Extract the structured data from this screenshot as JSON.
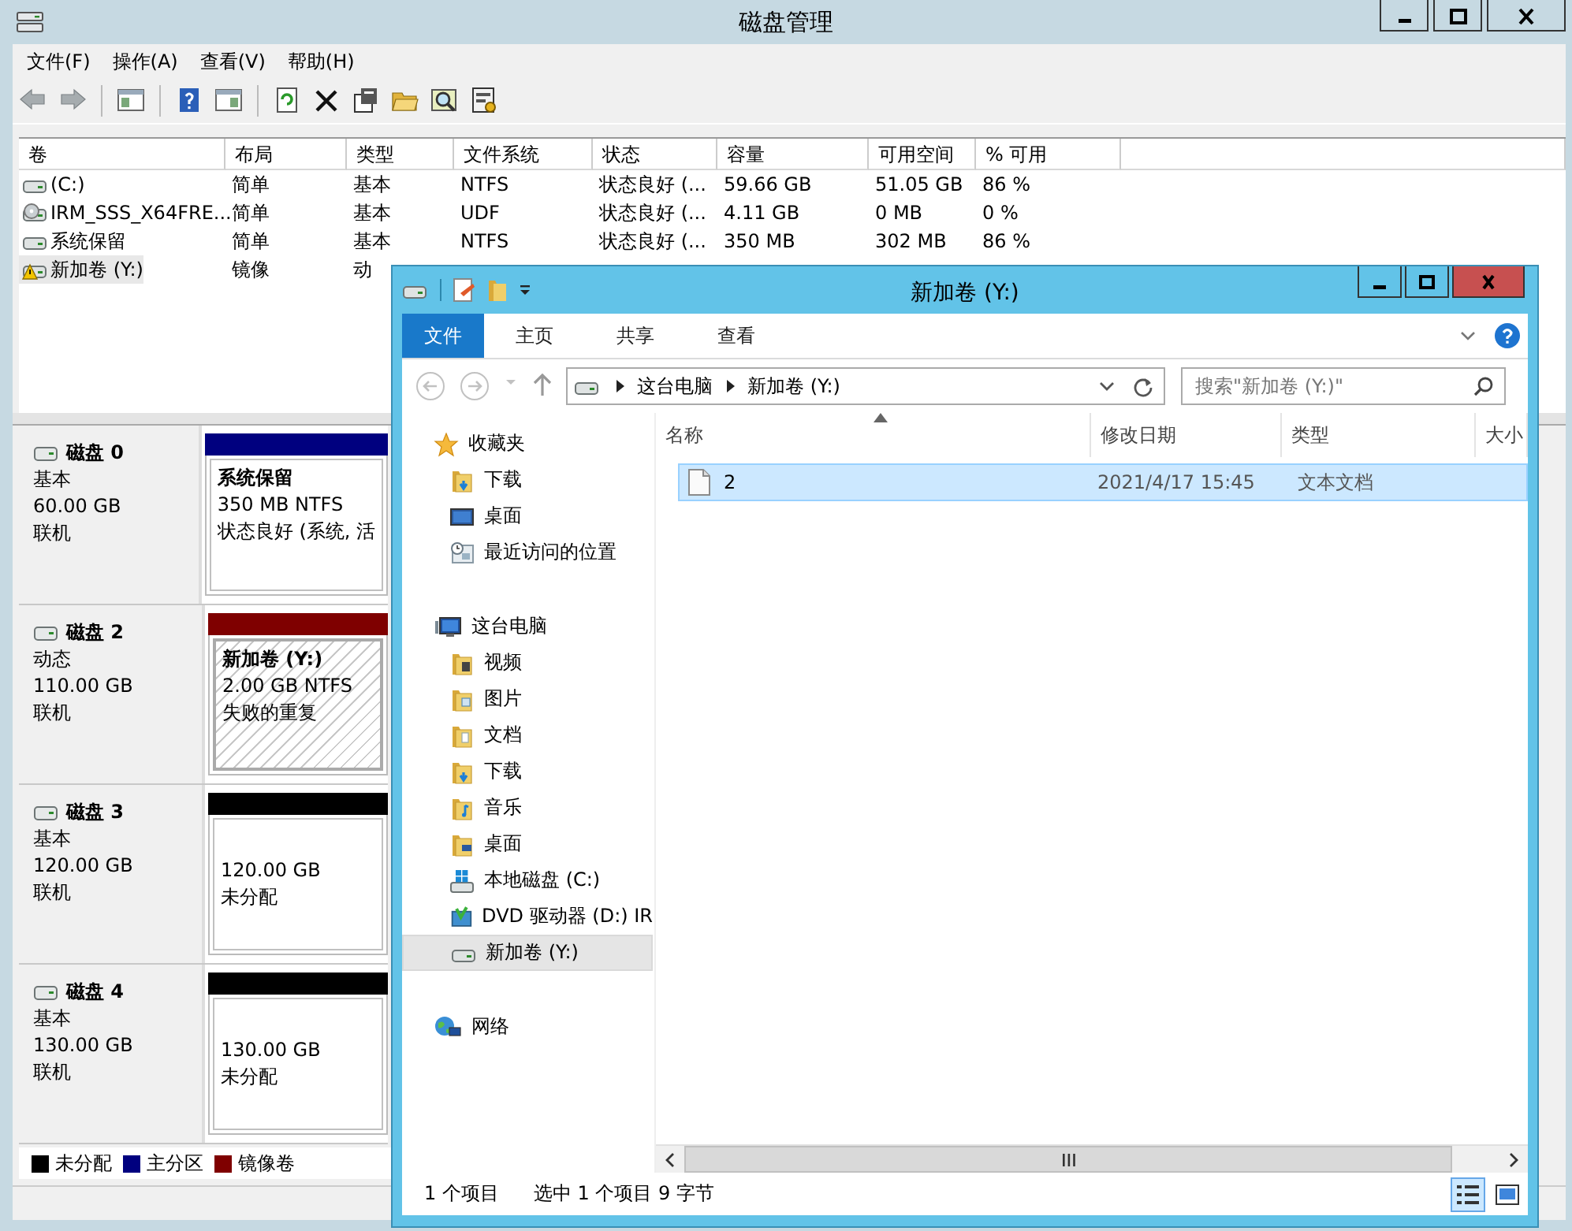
{
  "window": {
    "title": "磁盘管理"
  },
  "menu": [
    "文件(F)",
    "操作(A)",
    "查看(V)",
    "帮助(H)"
  ],
  "volumes": {
    "columns": [
      "卷",
      "布局",
      "类型",
      "文件系统",
      "状态",
      "容量",
      "可用空间",
      "% 可用"
    ],
    "rows": [
      {
        "kind": "drive",
        "selected": false,
        "cells": [
          "(C:)",
          "简单",
          "基本",
          "NTFS",
          "状态良好 (...",
          "59.66 GB",
          "51.05 GB",
          "86 %"
        ]
      },
      {
        "kind": "cd",
        "selected": false,
        "cells": [
          "IRM_SSS_X64FRE...",
          "简单",
          "基本",
          "UDF",
          "状态良好 (...",
          "4.11 GB",
          "0 MB",
          "0 %"
        ]
      },
      {
        "kind": "drive",
        "selected": false,
        "cells": [
          "系统保留",
          "简单",
          "基本",
          "NTFS",
          "状态良好 (...",
          "350 MB",
          "302 MB",
          "86 %"
        ]
      },
      {
        "kind": "warning",
        "selected": true,
        "cells": [
          "新加卷 (Y:)",
          "镜像",
          "动"
        ]
      }
    ]
  },
  "disks": [
    {
      "name": "磁盘 0",
      "type": "基本",
      "size": "60.00 GB",
      "status": "联机",
      "partition": {
        "kind": "primary",
        "color": "#00007f",
        "title": "系统保留",
        "lines": [
          "350 MB NTFS",
          "状态良好 (系统, 活"
        ]
      }
    },
    {
      "name": "磁盘 2",
      "type": "动态",
      "size": "110.00 GB",
      "status": "联机",
      "partition": {
        "kind": "mirror",
        "color": "#7f0000",
        "title": "新加卷  (Y:)",
        "lines": [
          "2.00 GB NTFS",
          "失败的重复"
        ]
      }
    },
    {
      "name": "磁盘 3",
      "type": "基本",
      "size": "120.00 GB",
      "status": "联机",
      "partition": {
        "kind": "unallocated",
        "color": "#000000",
        "lines": [
          "120.00 GB",
          "未分配"
        ]
      }
    },
    {
      "name": "磁盘 4",
      "type": "基本",
      "size": "130.00 GB",
      "status": "联机",
      "partition": {
        "kind": "unallocated",
        "color": "#000000",
        "lines": [
          "130.00 GB",
          "未分配"
        ]
      }
    }
  ],
  "legend": [
    {
      "label": "未分配",
      "color": "#000000"
    },
    {
      "label": "主分区",
      "color": "#00007f"
    },
    {
      "label": "镜像卷",
      "color": "#7f0000"
    }
  ],
  "explorer": {
    "title": "新加卷 (Y:)",
    "tabs": [
      {
        "label": "文件",
        "selected": true
      },
      {
        "label": "主页",
        "selected": false
      },
      {
        "label": "共享",
        "selected": false
      },
      {
        "label": "查看",
        "selected": false
      }
    ],
    "nav_buttons": [
      {
        "kind": "back",
        "disabled": true
      },
      {
        "kind": "forward",
        "disabled": true
      },
      {
        "kind": "recent",
        "disabled": true
      },
      {
        "kind": "up",
        "disabled": false
      }
    ],
    "breadcrumbs": [
      "这台电脑",
      "新加卷 (Y:)"
    ],
    "search": {
      "placeholder": "搜索\"新加卷 (Y:)\""
    },
    "tree": [
      {
        "label": "收藏夹",
        "kind": "star",
        "selected": false,
        "children": [
          {
            "label": "下载",
            "kind": "folder-download",
            "selected": false
          },
          {
            "label": "桌面",
            "kind": "desktop",
            "selected": false
          },
          {
            "label": "最近访问的位置",
            "kind": "recent",
            "selected": false
          }
        ]
      },
      {
        "label": "这台电脑",
        "kind": "computer",
        "selected": false,
        "children": [
          {
            "label": "视频",
            "kind": "folder-video",
            "selected": false
          },
          {
            "label": "图片",
            "kind": "folder-picture",
            "selected": false
          },
          {
            "label": "文档",
            "kind": "folder-doc",
            "selected": false
          },
          {
            "label": "下载",
            "kind": "folder-download",
            "selected": false
          },
          {
            "label": "音乐",
            "kind": "folder-music",
            "selected": false
          },
          {
            "label": "桌面",
            "kind": "folder-desktop",
            "selected": false
          },
          {
            "label": "本地磁盘 (C:)",
            "kind": "local-disk",
            "selected": false
          },
          {
            "label": "DVD 驱动器 (D:) IR",
            "kind": "dvd",
            "selected": false
          },
          {
            "label": "新加卷 (Y:)",
            "kind": "drive",
            "selected": true
          }
        ]
      },
      {
        "label": "网络",
        "kind": "network",
        "selected": false
      }
    ],
    "columns": [
      {
        "label": "名称",
        "sorted": true
      },
      {
        "label": "修改日期",
        "sorted": false
      },
      {
        "label": "类型",
        "sorted": false
      },
      {
        "label": "大小",
        "sorted": false
      }
    ],
    "files": [
      {
        "cells": [
          "2",
          "2021/4/17 15:45",
          "文本文档"
        ],
        "selected": true
      }
    ],
    "status": [
      "1 个项目",
      "选中 1 个项目  9 字节"
    ],
    "views": [
      {
        "kind": "details",
        "selected": true
      },
      {
        "kind": "thumbnails",
        "selected": false
      }
    ]
  }
}
